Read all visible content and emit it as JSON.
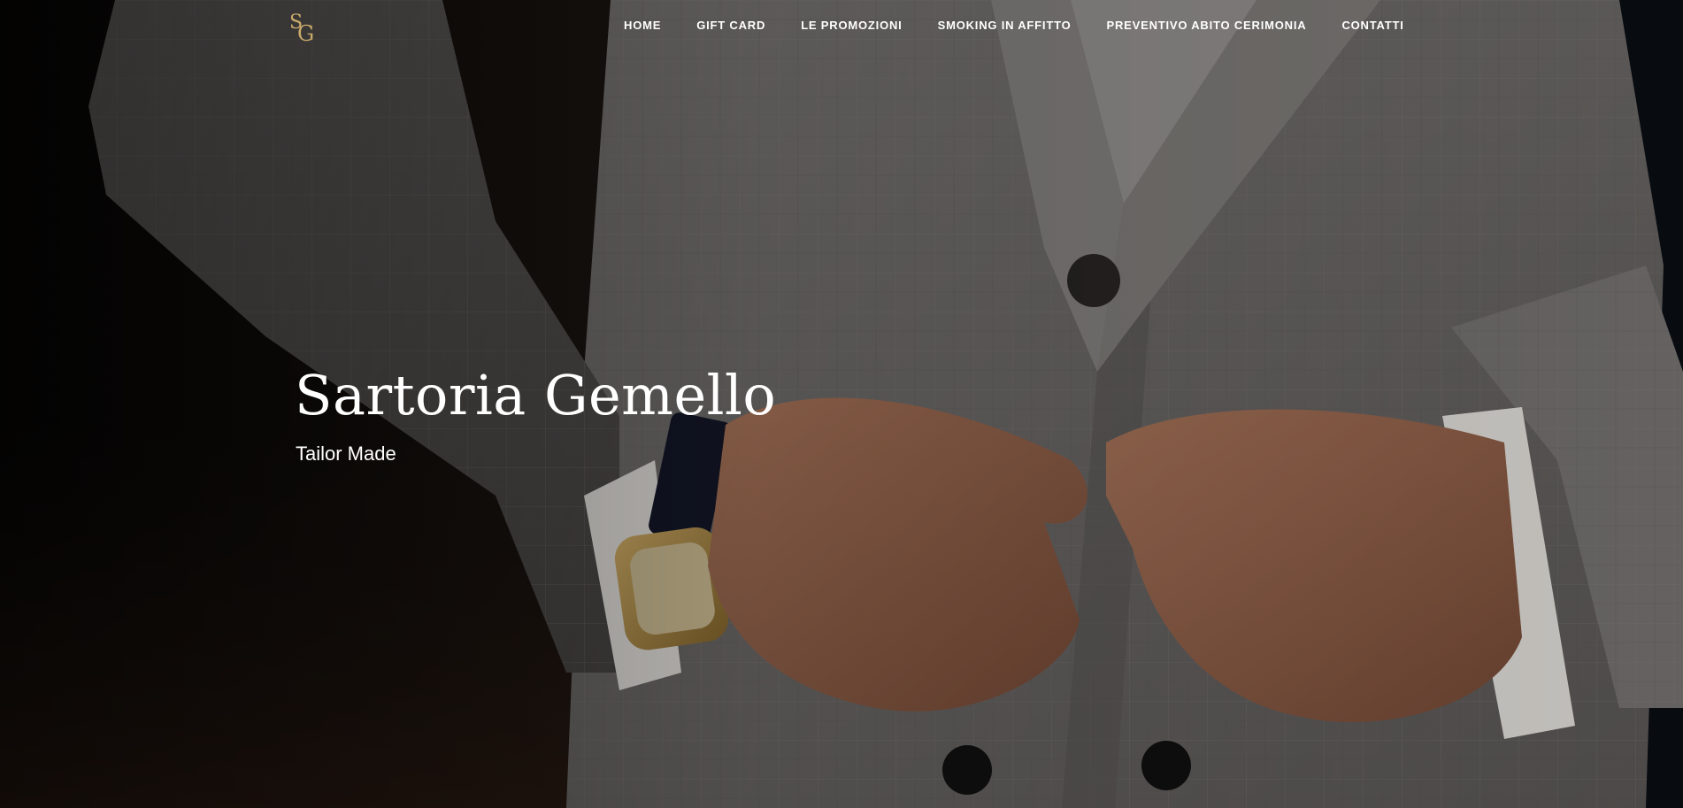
{
  "nav": {
    "logo_text": "SG",
    "items": [
      {
        "label": "HOME"
      },
      {
        "label": "GIFT CARD"
      },
      {
        "label": "LE PROMOZIONI"
      },
      {
        "label": "SMOKING IN AFFITTO"
      },
      {
        "label": "PREVENTIVO ABITO CERIMONIA"
      },
      {
        "label": "CONTATTI"
      }
    ]
  },
  "hero": {
    "title": "Sartoria Gemello",
    "subtitle": "Tailor Made"
  },
  "colors": {
    "logo_gold": "#c9a96a",
    "nav_text": "#ffffff",
    "hero_text": "#ffffff"
  }
}
